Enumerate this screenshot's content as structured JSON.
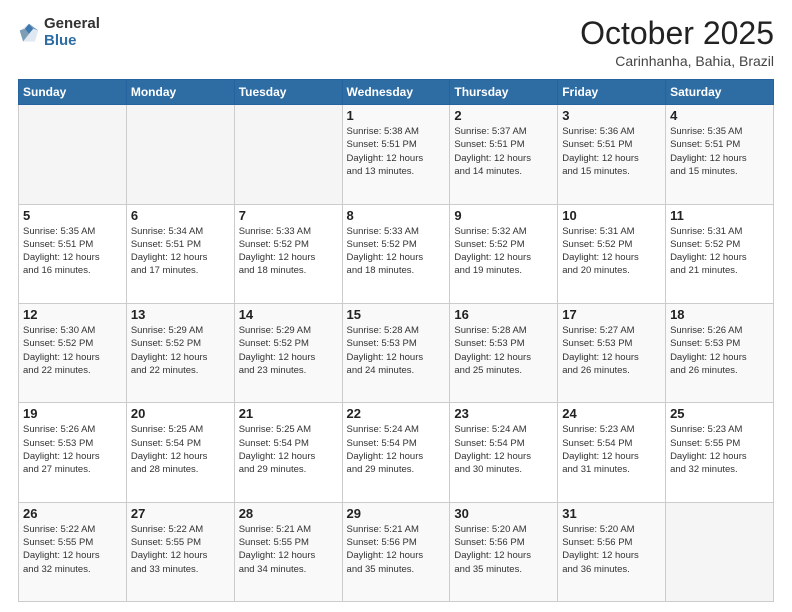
{
  "header": {
    "logo": {
      "general": "General",
      "blue": "Blue"
    },
    "month": "October 2025",
    "location": "Carinhanha, Bahia, Brazil"
  },
  "days_of_week": [
    "Sunday",
    "Monday",
    "Tuesday",
    "Wednesday",
    "Thursday",
    "Friday",
    "Saturday"
  ],
  "weeks": [
    [
      {
        "day": "",
        "info": ""
      },
      {
        "day": "",
        "info": ""
      },
      {
        "day": "",
        "info": ""
      },
      {
        "day": "1",
        "info": "Sunrise: 5:38 AM\nSunset: 5:51 PM\nDaylight: 12 hours\nand 13 minutes."
      },
      {
        "day": "2",
        "info": "Sunrise: 5:37 AM\nSunset: 5:51 PM\nDaylight: 12 hours\nand 14 minutes."
      },
      {
        "day": "3",
        "info": "Sunrise: 5:36 AM\nSunset: 5:51 PM\nDaylight: 12 hours\nand 15 minutes."
      },
      {
        "day": "4",
        "info": "Sunrise: 5:35 AM\nSunset: 5:51 PM\nDaylight: 12 hours\nand 15 minutes."
      }
    ],
    [
      {
        "day": "5",
        "info": "Sunrise: 5:35 AM\nSunset: 5:51 PM\nDaylight: 12 hours\nand 16 minutes."
      },
      {
        "day": "6",
        "info": "Sunrise: 5:34 AM\nSunset: 5:51 PM\nDaylight: 12 hours\nand 17 minutes."
      },
      {
        "day": "7",
        "info": "Sunrise: 5:33 AM\nSunset: 5:52 PM\nDaylight: 12 hours\nand 18 minutes."
      },
      {
        "day": "8",
        "info": "Sunrise: 5:33 AM\nSunset: 5:52 PM\nDaylight: 12 hours\nand 18 minutes."
      },
      {
        "day": "9",
        "info": "Sunrise: 5:32 AM\nSunset: 5:52 PM\nDaylight: 12 hours\nand 19 minutes."
      },
      {
        "day": "10",
        "info": "Sunrise: 5:31 AM\nSunset: 5:52 PM\nDaylight: 12 hours\nand 20 minutes."
      },
      {
        "day": "11",
        "info": "Sunrise: 5:31 AM\nSunset: 5:52 PM\nDaylight: 12 hours\nand 21 minutes."
      }
    ],
    [
      {
        "day": "12",
        "info": "Sunrise: 5:30 AM\nSunset: 5:52 PM\nDaylight: 12 hours\nand 22 minutes."
      },
      {
        "day": "13",
        "info": "Sunrise: 5:29 AM\nSunset: 5:52 PM\nDaylight: 12 hours\nand 22 minutes."
      },
      {
        "day": "14",
        "info": "Sunrise: 5:29 AM\nSunset: 5:52 PM\nDaylight: 12 hours\nand 23 minutes."
      },
      {
        "day": "15",
        "info": "Sunrise: 5:28 AM\nSunset: 5:53 PM\nDaylight: 12 hours\nand 24 minutes."
      },
      {
        "day": "16",
        "info": "Sunrise: 5:28 AM\nSunset: 5:53 PM\nDaylight: 12 hours\nand 25 minutes."
      },
      {
        "day": "17",
        "info": "Sunrise: 5:27 AM\nSunset: 5:53 PM\nDaylight: 12 hours\nand 26 minutes."
      },
      {
        "day": "18",
        "info": "Sunrise: 5:26 AM\nSunset: 5:53 PM\nDaylight: 12 hours\nand 26 minutes."
      }
    ],
    [
      {
        "day": "19",
        "info": "Sunrise: 5:26 AM\nSunset: 5:53 PM\nDaylight: 12 hours\nand 27 minutes."
      },
      {
        "day": "20",
        "info": "Sunrise: 5:25 AM\nSunset: 5:54 PM\nDaylight: 12 hours\nand 28 minutes."
      },
      {
        "day": "21",
        "info": "Sunrise: 5:25 AM\nSunset: 5:54 PM\nDaylight: 12 hours\nand 29 minutes."
      },
      {
        "day": "22",
        "info": "Sunrise: 5:24 AM\nSunset: 5:54 PM\nDaylight: 12 hours\nand 29 minutes."
      },
      {
        "day": "23",
        "info": "Sunrise: 5:24 AM\nSunset: 5:54 PM\nDaylight: 12 hours\nand 30 minutes."
      },
      {
        "day": "24",
        "info": "Sunrise: 5:23 AM\nSunset: 5:54 PM\nDaylight: 12 hours\nand 31 minutes."
      },
      {
        "day": "25",
        "info": "Sunrise: 5:23 AM\nSunset: 5:55 PM\nDaylight: 12 hours\nand 32 minutes."
      }
    ],
    [
      {
        "day": "26",
        "info": "Sunrise: 5:22 AM\nSunset: 5:55 PM\nDaylight: 12 hours\nand 32 minutes."
      },
      {
        "day": "27",
        "info": "Sunrise: 5:22 AM\nSunset: 5:55 PM\nDaylight: 12 hours\nand 33 minutes."
      },
      {
        "day": "28",
        "info": "Sunrise: 5:21 AM\nSunset: 5:55 PM\nDaylight: 12 hours\nand 34 minutes."
      },
      {
        "day": "29",
        "info": "Sunrise: 5:21 AM\nSunset: 5:56 PM\nDaylight: 12 hours\nand 35 minutes."
      },
      {
        "day": "30",
        "info": "Sunrise: 5:20 AM\nSunset: 5:56 PM\nDaylight: 12 hours\nand 35 minutes."
      },
      {
        "day": "31",
        "info": "Sunrise: 5:20 AM\nSunset: 5:56 PM\nDaylight: 12 hours\nand 36 minutes."
      },
      {
        "day": "",
        "info": ""
      }
    ]
  ]
}
